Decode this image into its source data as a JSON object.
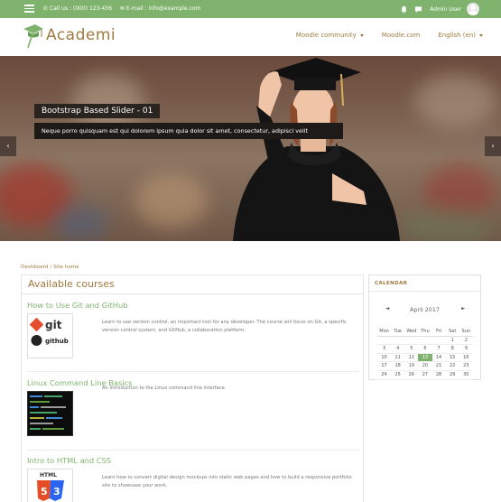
{
  "topbar": {
    "phone": "Call us : (000) 123-456",
    "email": "E-mail : info@example.com",
    "user": "Admin User"
  },
  "header": {
    "brand": "Academi",
    "nav": [
      {
        "label": "Moodle community",
        "dropdown": true
      },
      {
        "label": "Moodle.com",
        "dropdown": false
      },
      {
        "label": "English (en)",
        "dropdown": true
      }
    ]
  },
  "slider": {
    "title": "Bootstrap Based Slider - 01",
    "caption": "Neque porro quisquam est qui dolorem ipsum quia dolor sit amet, consectetur, adipisci velit",
    "prev_icon": "chevron-left-icon",
    "next_icon": "chevron-right-icon"
  },
  "breadcrumb": {
    "items": [
      "Dashboard",
      "Site home"
    ],
    "separator": "/"
  },
  "courses": {
    "heading": "Available courses",
    "items": [
      {
        "title": "How to Use Git and GitHub",
        "description": "Learn to use version control, an important tool for any developer. The course will focus on Git, a specific version control system, and GitHub, a collaboration platform.",
        "thumb": "git-github-logo",
        "thumb_text": [
          "git",
          "github"
        ]
      },
      {
        "title": "Linux Command Line Basics",
        "description": "An introduction to the Linux command line interface.",
        "thumb": "terminal-screenshot"
      },
      {
        "title": "Intro to HTML and CSS",
        "description": "Learn how to convert digital design mockups into static web pages and how to build a responsive portfolio site to showcase your work.",
        "thumb": "html5-css3-logo",
        "thumb_text": [
          "HTML"
        ]
      }
    ]
  },
  "calendar": {
    "title": "CALENDAR",
    "month": "April 2017",
    "prev": "◄",
    "next": "►",
    "days": [
      "Mon",
      "Tue",
      "Wed",
      "Thu",
      "Fri",
      "Sat",
      "Sun"
    ],
    "weeks": [
      [
        "",
        "",
        "",
        "",
        "",
        "1",
        "2"
      ],
      [
        "3",
        "4",
        "5",
        "6",
        "7",
        "8",
        "9"
      ],
      [
        "10",
        "11",
        "12",
        "13",
        "14",
        "15",
        "16"
      ],
      [
        "17",
        "18",
        "19",
        "20",
        "21",
        "22",
        "23"
      ],
      [
        "24",
        "25",
        "26",
        "27",
        "28",
        "29",
        "30"
      ]
    ],
    "today": "13"
  },
  "colors": {
    "brand_green": "#7fb36d",
    "accent_brown": "#a07a40"
  }
}
